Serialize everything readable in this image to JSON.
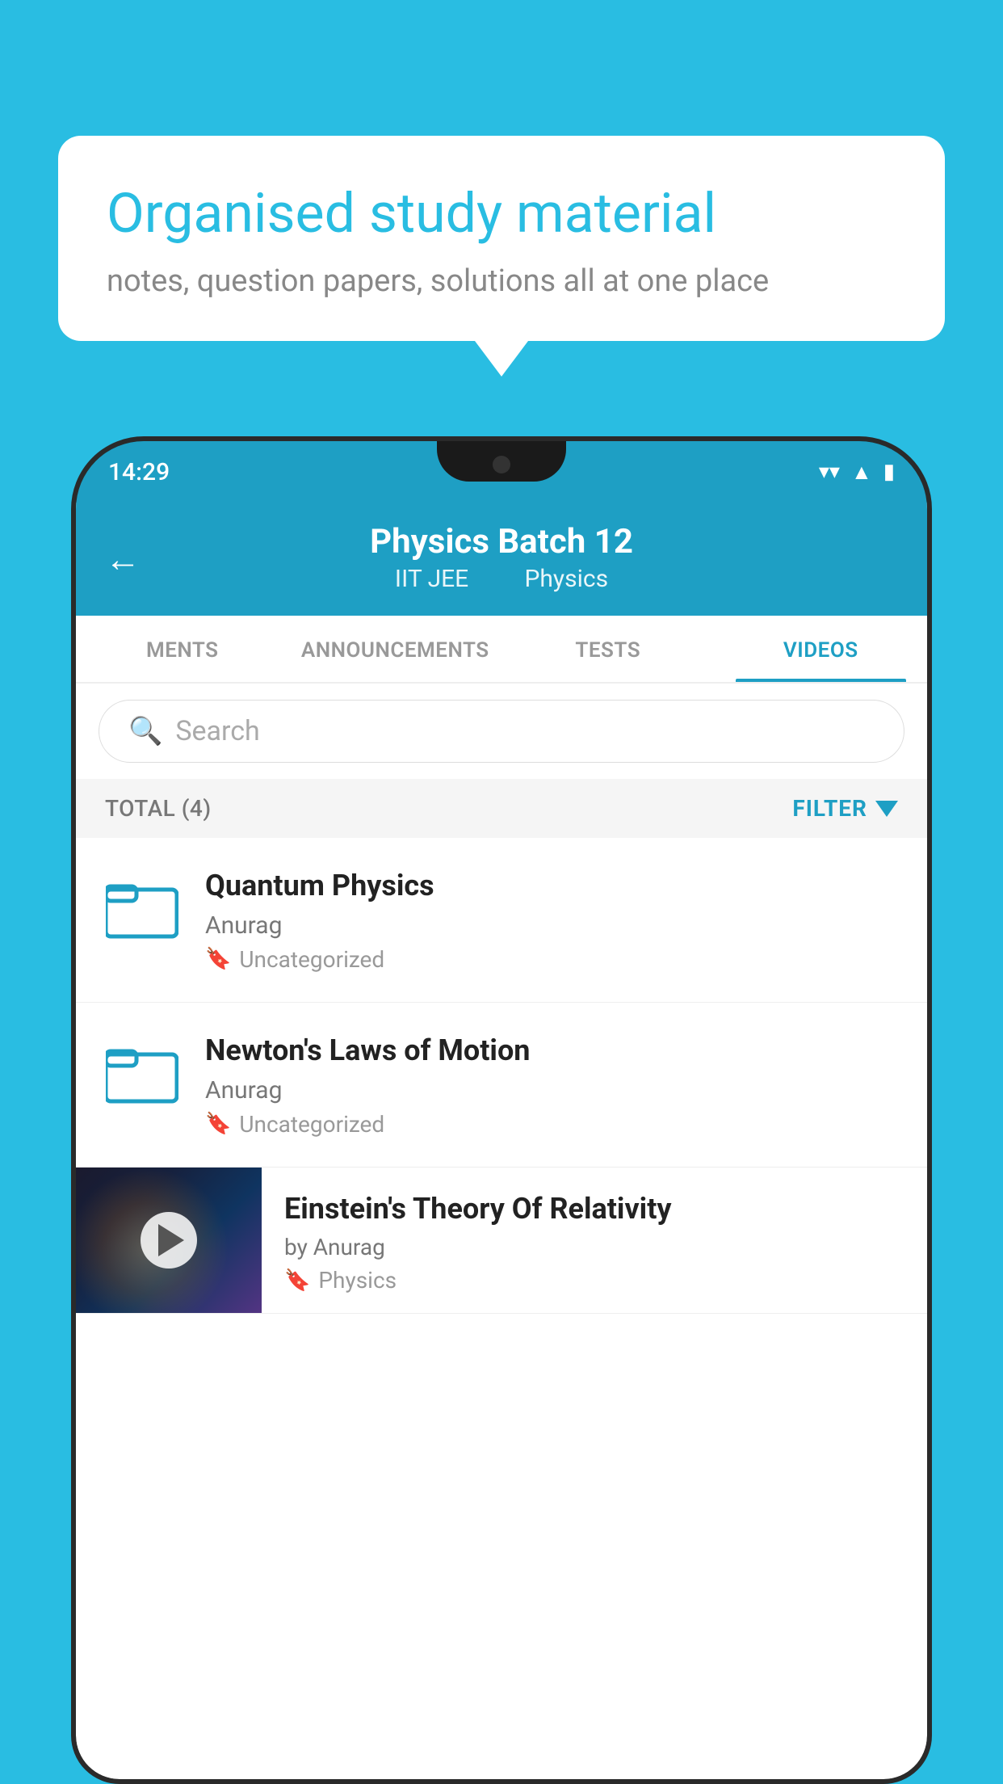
{
  "background": {
    "color": "#29bde2"
  },
  "speech_bubble": {
    "title": "Organised study material",
    "subtitle": "notes, question papers, solutions all at one place"
  },
  "phone": {
    "status_bar": {
      "time": "14:29"
    },
    "header": {
      "title": "Physics Batch 12",
      "subtitle_part1": "IIT JEE",
      "subtitle_part2": "Physics",
      "back_label": "←"
    },
    "tabs": [
      {
        "label": "MENTS",
        "active": false
      },
      {
        "label": "ANNOUNCEMENTS",
        "active": false
      },
      {
        "label": "TESTS",
        "active": false
      },
      {
        "label": "VIDEOS",
        "active": true
      }
    ],
    "search": {
      "placeholder": "Search"
    },
    "filter_bar": {
      "total_label": "TOTAL (4)",
      "filter_label": "FILTER"
    },
    "videos": [
      {
        "title": "Quantum Physics",
        "author": "Anurag",
        "tag": "Uncategorized",
        "has_thumbnail": false
      },
      {
        "title": "Newton's Laws of Motion",
        "author": "Anurag",
        "tag": "Uncategorized",
        "has_thumbnail": false
      },
      {
        "title": "Einstein's Theory Of Relativity",
        "author": "by Anurag",
        "tag": "Physics",
        "has_thumbnail": true
      }
    ]
  }
}
